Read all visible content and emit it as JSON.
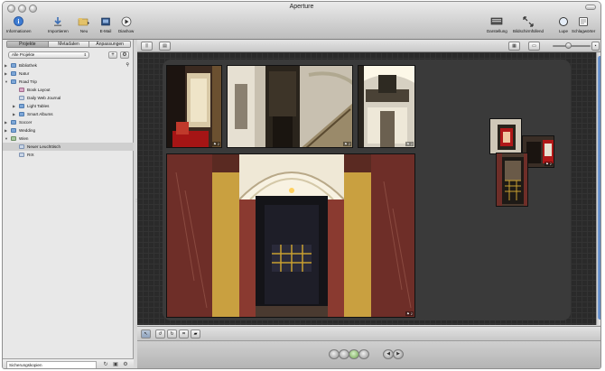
{
  "window": {
    "title": "Aperture"
  },
  "toolbar": {
    "left": [
      {
        "label": "Informationen",
        "icon": "info-icon"
      },
      {
        "label": "Importieren",
        "icon": "import-icon"
      },
      {
        "label": "Neu",
        "icon": "new-folder-icon"
      },
      {
        "label": "E-Mail",
        "icon": "email-icon"
      },
      {
        "label": "Diashow",
        "icon": "slideshow-icon"
      }
    ],
    "right": [
      {
        "label": "Darstellung",
        "icon": "layout-icon"
      },
      {
        "label": "Bildschirmfüllend",
        "icon": "fullscreen-icon"
      },
      {
        "label": "Lupe",
        "icon": "loupe-icon"
      },
      {
        "label": "Schlagwörter",
        "icon": "keywords-icon"
      }
    ]
  },
  "sidebar": {
    "tabs": [
      "Projekte",
      "Metadaten",
      "Anpassungen"
    ],
    "active_tab": "Projekte",
    "project_filter": "Alle Projekte",
    "tree": [
      {
        "label": "Bibliothek",
        "type": "folder",
        "level": 0,
        "disclosure": "▶"
      },
      {
        "label": "Natur",
        "type": "folder",
        "level": 0,
        "disclosure": "▶"
      },
      {
        "label": "Road Trip",
        "type": "folder",
        "level": 0,
        "disclosure": "▼"
      },
      {
        "label": "Book Layout",
        "type": "book",
        "level": 1,
        "disclosure": ""
      },
      {
        "label": "Daily Web Journal",
        "type": "album",
        "level": 1,
        "disclosure": ""
      },
      {
        "label": "Light Tables",
        "type": "folder",
        "level": 1,
        "disclosure": "▶"
      },
      {
        "label": "Smart Albums",
        "type": "folder",
        "level": 1,
        "disclosure": "▶"
      },
      {
        "label": "Soccer",
        "type": "folder",
        "level": 0,
        "disclosure": "▶"
      },
      {
        "label": "Wedding",
        "type": "folder",
        "level": 0,
        "disclosure": "▶"
      },
      {
        "label": "Wien",
        "type": "proj",
        "level": 0,
        "disclosure": "▼"
      },
      {
        "label": "Neuer Leuchttisch",
        "type": "album",
        "level": 1,
        "disclosure": "",
        "selected": true
      },
      {
        "label": "RIX",
        "type": "album",
        "level": 1,
        "disclosure": ""
      }
    ],
    "backup_label": "Sicherungskopien"
  },
  "colors": {
    "lighttable_bg": "#2a2a2a",
    "stage_bg": "#3a3a3a",
    "scroll_accent": "#3f6fb8",
    "selection_gray": "#cfcfcf"
  },
  "photos": [
    {
      "name": "photo-red-lobby",
      "badge": "⚑ 2"
    },
    {
      "name": "photo-elevator-staircase",
      "badge": "⚑ 2"
    },
    {
      "name": "photo-staircase-window",
      "badge": "⚑ 2"
    },
    {
      "name": "photo-marble-corridor",
      "badge": "⚑ 2"
    },
    {
      "name": "photo-stack-elevator",
      "badge": "⚑ 2"
    }
  ]
}
